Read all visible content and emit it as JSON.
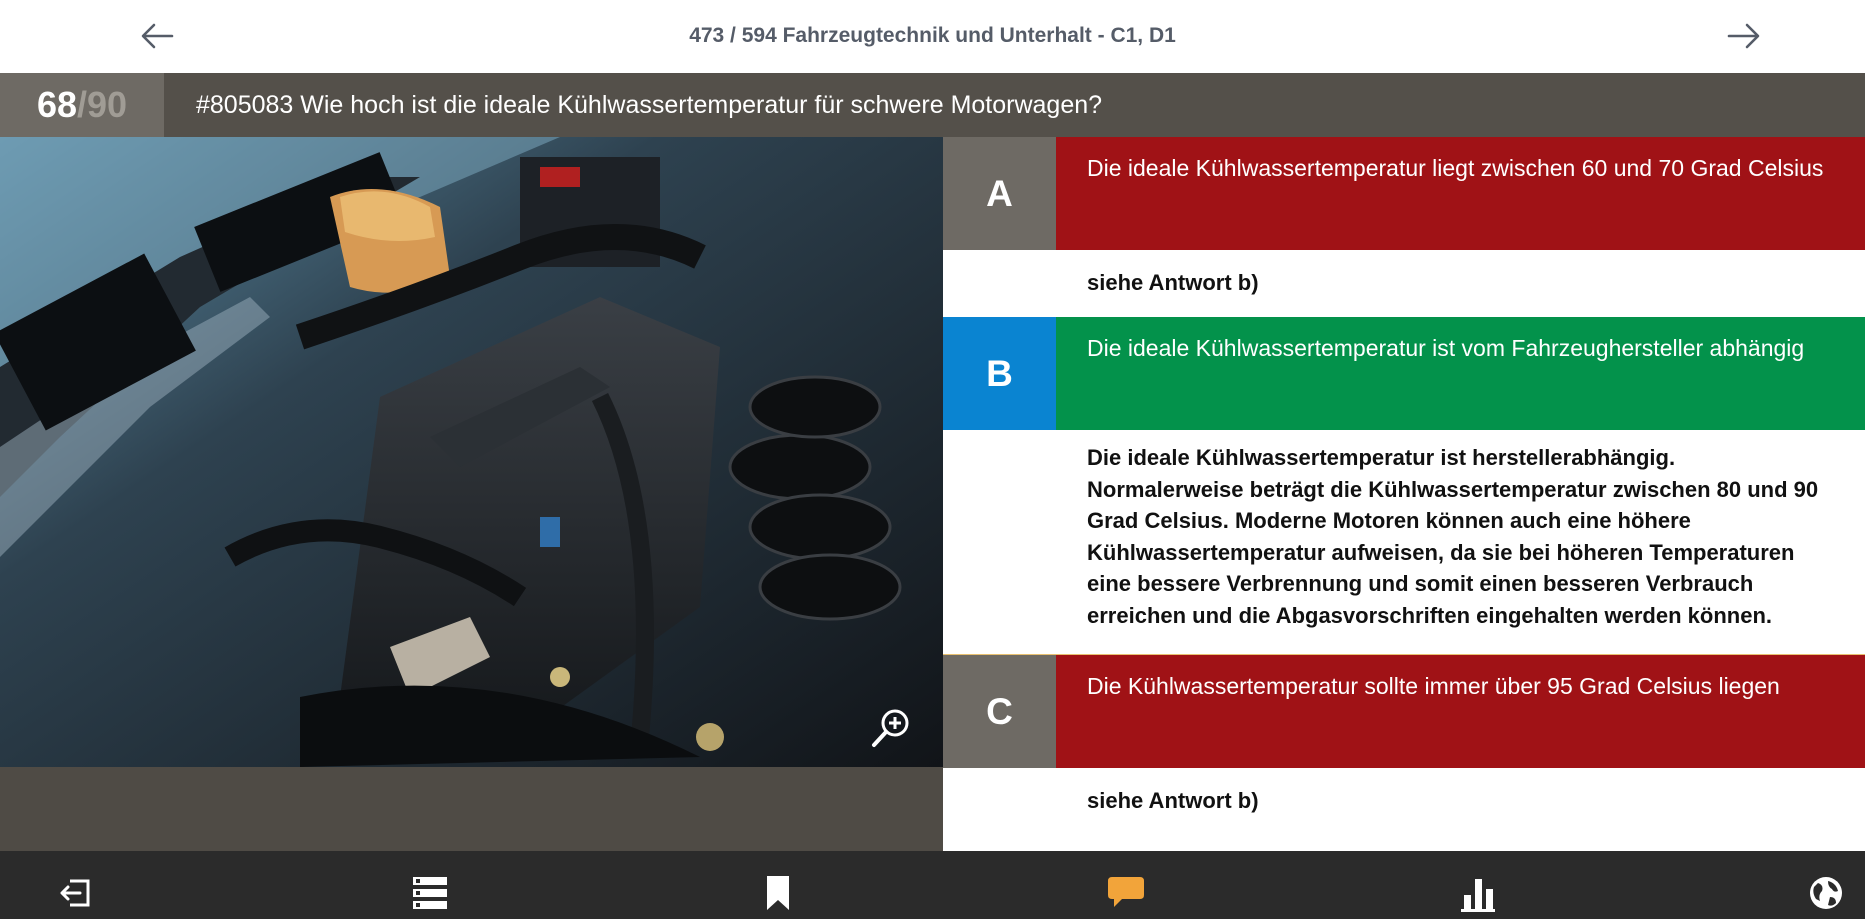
{
  "header": {
    "title": "473 / 594 Fahrzeugtechnik und Unterhalt - C1, D1",
    "prev_icon": "arrow-left-icon",
    "next_icon": "arrow-right-icon"
  },
  "question": {
    "counter_current": "68",
    "counter_separator": "/",
    "counter_total": "90",
    "text": "#805083 Wie hoch ist die ideale Kühlwassertemperatur für schwere Motorwagen?"
  },
  "image": {
    "zoom_icon": "zoom-in-icon"
  },
  "answers": [
    {
      "letter": "A",
      "text": "Die ideale Kühlwassertemperatur liegt zwischen 60 und 70 Grad Celsius",
      "letter_color": "#6e6a64",
      "bg_color": "#a01216",
      "explanation": [
        "siehe Antwort b)"
      ]
    },
    {
      "letter": "B",
      "text": "Die ideale Kühlwassertemperatur ist vom Fahrzeughersteller abhängig",
      "letter_color": "#0a84d1",
      "bg_color": "#03924b",
      "explanation": [
        "Die ideale Kühlwassertemperatur ist herstellerabhängig.",
        "Normalerweise beträgt die Kühlwassertemperatur zwischen 80 und 90",
        "Grad Celsius. Moderne Motoren können auch eine höhere",
        "Kühlwassertemperatur aufweisen, da sie bei höheren Temperaturen",
        "eine bessere Verbrennung und somit einen besseren Verbrauch",
        "erreichen und die Abgasvorschriften eingehalten werden können."
      ]
    },
    {
      "letter": "C",
      "text": "Die Kühlwassertemperatur sollte immer über 95 Grad Celsius liegen",
      "letter_color": "#6e6a64",
      "bg_color": "#a01216",
      "explanation": [
        "siehe Antwort b)"
      ]
    }
  ],
  "toolbar": {
    "items": [
      {
        "icon": "exit-icon",
        "color": "#ffffff"
      },
      {
        "icon": "list-icon",
        "color": "#ffffff"
      },
      {
        "icon": "bookmark-icon",
        "color": "#ffffff"
      },
      {
        "icon": "comment-icon",
        "color": "#f2a43a"
      },
      {
        "icon": "statistics-icon",
        "color": "#ffffff"
      },
      {
        "icon": "globe-icon",
        "color": "#ffffff"
      }
    ]
  }
}
